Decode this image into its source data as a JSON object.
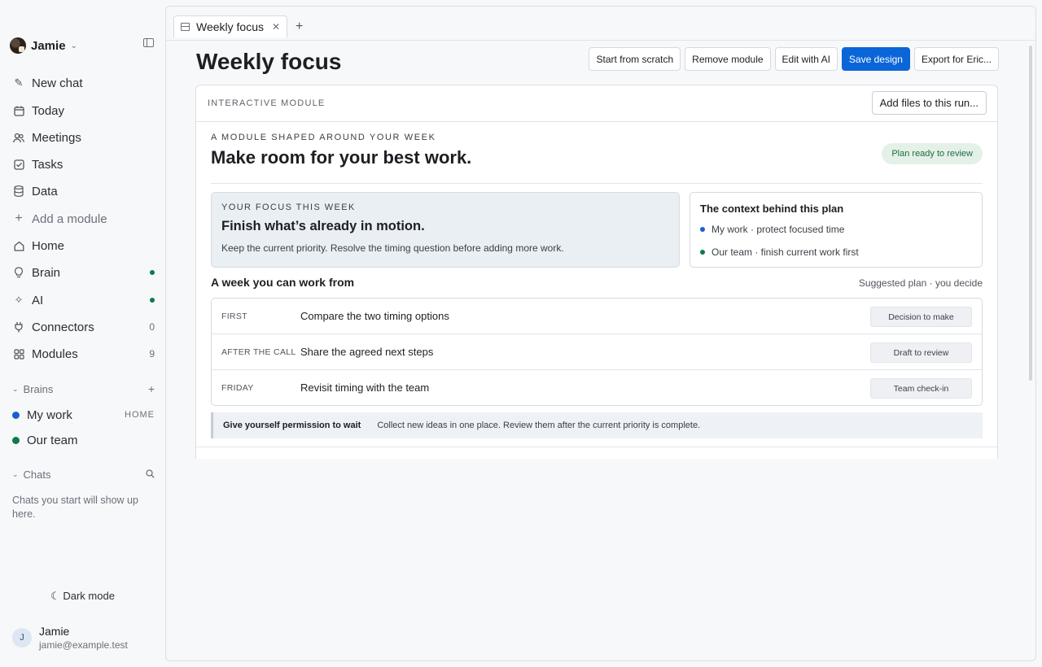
{
  "workspace": {
    "name": "Jamie"
  },
  "nav": {
    "items": [
      {
        "label": "New chat",
        "icon": "pencil-icon"
      },
      {
        "label": "Today",
        "icon": "calendar-icon"
      },
      {
        "label": "Meetings",
        "icon": "people-icon"
      },
      {
        "label": "Tasks",
        "icon": "checkbox-icon"
      },
      {
        "label": "Data",
        "icon": "database-icon"
      },
      {
        "label": "Add a module",
        "icon": "plus-icon"
      },
      {
        "label": "Home",
        "icon": "home-icon"
      },
      {
        "label": "Brain",
        "icon": "lightbulb-icon",
        "status": "green-dot"
      },
      {
        "label": "AI",
        "icon": "sparkle-icon",
        "status": "green-dot"
      },
      {
        "label": "Connectors",
        "icon": "plug-icon",
        "count": "0"
      },
      {
        "label": "Modules",
        "icon": "grid-icon",
        "count": "9"
      }
    ]
  },
  "brains": {
    "header": "Brains",
    "items": [
      {
        "label": "My work",
        "tag": "HOME",
        "color": "#1a5fd0"
      },
      {
        "label": "Our team",
        "tag": "",
        "color": "#0d7a4a"
      }
    ]
  },
  "chats": {
    "header": "Chats",
    "empty": "Chats you start will show up here."
  },
  "footer": {
    "dark_mode": "Dark mode",
    "user_initial": "J",
    "user_name": "Jamie",
    "user_email": "jamie@example.test"
  },
  "tab": {
    "title": "Weekly focus"
  },
  "page": {
    "title": "Weekly focus",
    "toolbar": {
      "start_from_scratch": "Start from scratch",
      "remove_module": "Remove module",
      "edit_with_ai": "Edit with AI",
      "save_design": "Save design",
      "export": "Export for Eric..."
    }
  },
  "module": {
    "label": "INTERACTIVE MODULE",
    "add_files": "Add files to this run...",
    "kicker": "A MODULE SHAPED AROUND YOUR WEEK",
    "headline": "Make room for your best work.",
    "status": "Plan ready to review",
    "focus": {
      "kicker": "YOUR FOCUS THIS WEEK",
      "title": "Finish what’s already in motion.",
      "body": "Keep the current priority. Resolve the timing question before adding more work."
    },
    "context": {
      "title": "The context behind this plan",
      "lines": [
        {
          "text": "My work · protect focused time",
          "color": "#1a5fd0"
        },
        {
          "text": "Our team · finish current work first",
          "color": "#0d7a4a"
        }
      ]
    },
    "week": {
      "title": "A week you can work from",
      "note": "Suggested plan · you decide",
      "rows": [
        {
          "when": "FIRST",
          "what": "Compare the two timing options",
          "tag": "Decision to make"
        },
        {
          "when": "AFTER THE CALL",
          "what": "Share the agreed next steps",
          "tag": "Draft to review"
        },
        {
          "when": "FRIDAY",
          "what": "Revisit timing with the team",
          "tag": "Team check-in"
        }
      ]
    },
    "permission": {
      "title": "Give yourself permission to wait",
      "text": "Collect new ideas in one place. Review them after the current priority is complete."
    }
  },
  "colors": {
    "accent": "#0a66d8",
    "status_green": "#0d7a4a",
    "brain_blue": "#1a5fd0"
  }
}
